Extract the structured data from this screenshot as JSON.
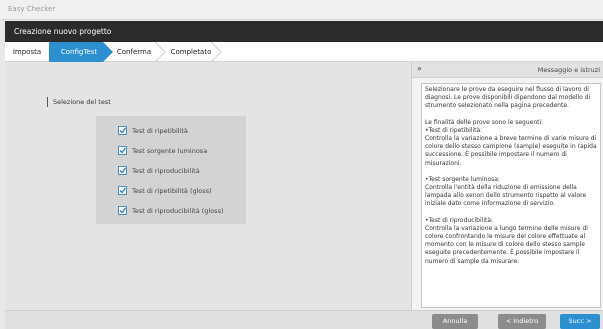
{
  "window": {
    "title": "Easy Checker"
  },
  "header": {
    "title": "Creazione nuovo progetto"
  },
  "steps": [
    {
      "label": "Imposta"
    },
    {
      "label": "ConfigTest"
    },
    {
      "label": "Conferma"
    },
    {
      "label": "Completato"
    }
  ],
  "main": {
    "section_label": "Selezione del test",
    "tests": [
      {
        "label": "Test di ripetibilità",
        "checked": true
      },
      {
        "label": "Test sorgente luminosa",
        "checked": true
      },
      {
        "label": "Test di riproducibilità",
        "checked": true
      },
      {
        "label": "Test di ripetibilità (gloss)",
        "checked": true
      },
      {
        "label": "Test di riproducibilità (gloss)",
        "checked": true
      }
    ]
  },
  "panel": {
    "toggle": "»",
    "title": "Messaggio e istruzi",
    "paragraphs": [
      "Selezionare le prove da eseguire nel flusso di lavoro di diagnosi. Le prove disponibili dipendono dal modello di strumento selezionato nella pagina precedente.",
      "Le finalità delle prove sono le seguenti:\n•Test di ripetibilità:\nControlla la variazione a breve termine di varie misure di colore dello stesso campione (sample) eseguite in rapida successione. È possibile impostare il numero di misurazioni.",
      "•Test sorgente luminosa:\nControlla l'entità della riduzione di emissione della lampada allo xenon dello strumento rispetto al valore iniziale dato come informazione di servizio.",
      "•Test di riproducibilità:\nControlla la variazione a lungo termine delle misure di colore confrontando le misure del colore effettuate al momento con le misure di colore dello stesso sample eseguite precedentemente. È possibile impostare il numero di sample da misurare."
    ]
  },
  "footer": {
    "cancel_label": "Annulla",
    "back_label": "< Indietro",
    "next_label": "Succ >"
  },
  "colors": {
    "accent": "#2b8fd0",
    "header_bg": "#2b2b2b",
    "button_gray": "#8c8c8c"
  }
}
